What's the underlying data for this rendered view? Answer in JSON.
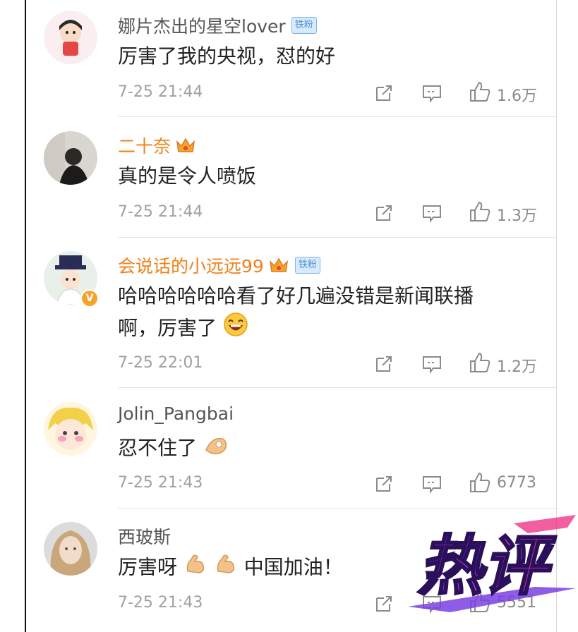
{
  "comments": [
    {
      "username": "娜片杰出的星空lover",
      "fan_badge": "铁粉",
      "text": "厉害了我的央视，怼的好",
      "time": "7-25 21:44",
      "likes": "1.6万"
    },
    {
      "username": "二十奈",
      "text": "真的是令人喷饭",
      "time": "7-25 21:44",
      "likes": "1.3万"
    },
    {
      "username": "会说话的小远远99",
      "fan_badge": "铁粉",
      "text_line1": "哈哈哈哈哈哈看了好几遍没错是新闻联播",
      "text_line2": "啊，厉害了",
      "verified": "V",
      "time": "7-25 22:01",
      "likes": "1.2万"
    },
    {
      "username": "Jolin_Pangbai",
      "text": "忍不住了",
      "time": "7-25 21:43",
      "likes": "6773"
    },
    {
      "username": "西玻斯",
      "text_a": "厉害呀",
      "text_b": "中国加油！",
      "time": "7-25 21:43",
      "likes": "5551"
    }
  ],
  "watermark": {
    "text": "热评"
  },
  "colors": {
    "vip_name": "#f08118",
    "meta": "#a0a0a0",
    "watermark_a": "#7b3fe4",
    "watermark_b": "#f0368a"
  },
  "icons": [
    "forward-icon",
    "comment-icon",
    "like-icon",
    "crown-icon",
    "emoji-laugh-icon",
    "emoji-ok-hand-icon",
    "emoji-muscle-icon"
  ]
}
